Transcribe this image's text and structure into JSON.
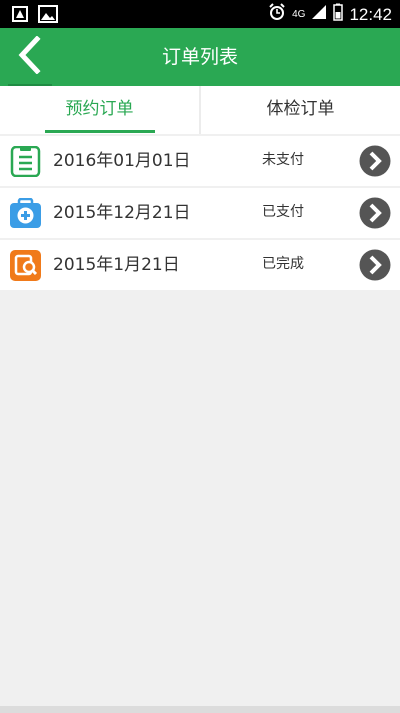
{
  "status_bar": {
    "time": "12:42",
    "network": "4G",
    "icons": [
      "notification-icon",
      "image-icon",
      "alarm-icon",
      "signal-icon",
      "battery-icon"
    ]
  },
  "app_bar": {
    "title": "订单列表",
    "back_icon": "chevron-left-icon",
    "color": "#2aa853"
  },
  "tabs": [
    {
      "label": "预约订单",
      "active": true
    },
    {
      "label": "体检订单",
      "active": false
    }
  ],
  "orders": [
    {
      "date": "2016年01月01日",
      "status": "未支付",
      "icon": "clipboard-icon",
      "icon_color": "#2aa853"
    },
    {
      "date": "2015年12月21日",
      "status": "已支付",
      "icon": "medical-case-icon",
      "icon_color": "#3b9de6"
    },
    {
      "date": "2015年1月21日",
      "status": "已完成",
      "icon": "report-search-icon",
      "icon_color": "#f07a1a"
    }
  ]
}
